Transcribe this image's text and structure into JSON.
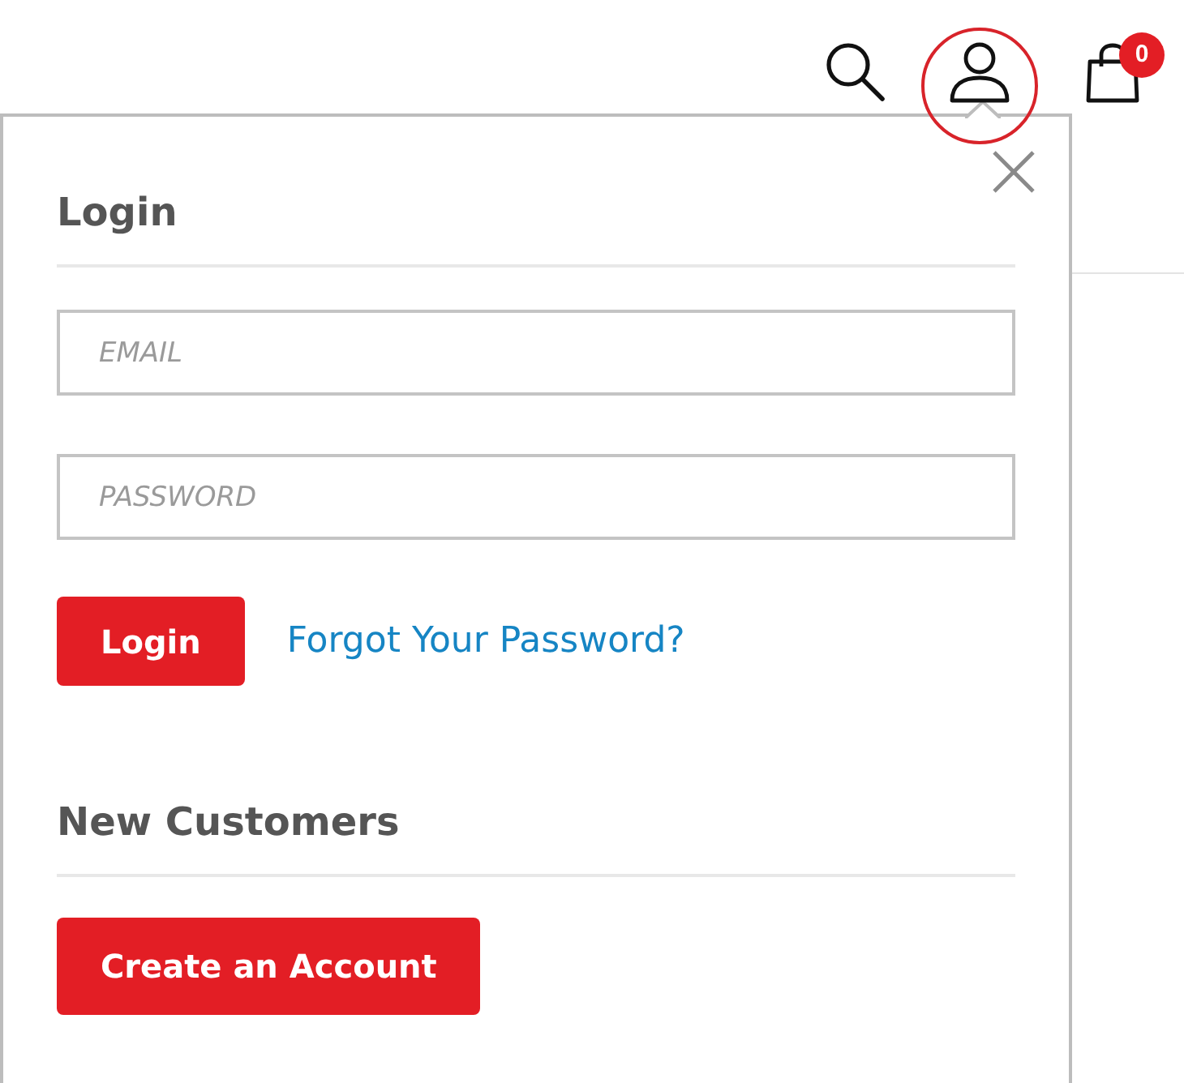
{
  "header": {
    "account": {
      "highlighted": true
    },
    "cart_count": "0"
  },
  "login": {
    "title": "Login",
    "fields": [
      {
        "placeholder": "EMAIL"
      },
      {
        "placeholder": "PASSWORD"
      }
    ],
    "submit": "Login",
    "forgot_link": "Forgot Your Password?"
  },
  "new_customers": {
    "title": "New Customers",
    "button": "Create an Account"
  }
}
